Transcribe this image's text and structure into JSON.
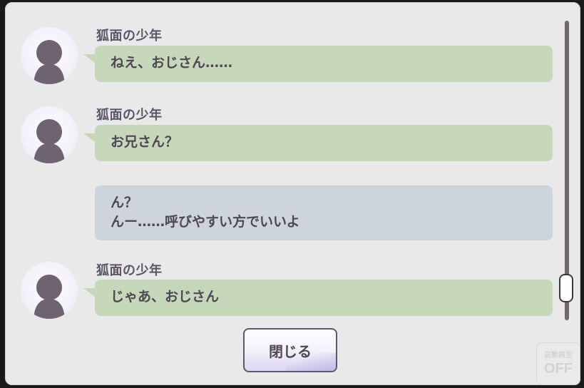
{
  "log": {
    "entries": [
      {
        "speaker": "狐面の少年",
        "text": "ねえ、おじさん……"
      },
      {
        "speaker": "狐面の少年",
        "text": "お兄さん？"
      },
      {
        "speaker": "",
        "lines": [
          "ん？",
          "んー……呼びやすい方でいいよ"
        ]
      },
      {
        "speaker": "狐面の少年",
        "text": "じゃあ、おじさん"
      }
    ]
  },
  "close_button": {
    "label": "閉じる"
  },
  "auto_toggle": {
    "small_label": "自動再生",
    "state": "OFF"
  },
  "colors": {
    "npc_bubble": "#c7d7b9",
    "player_bubble": "#cdd4dc",
    "text": "#4f4656",
    "panel": "#e9e9ea"
  },
  "icons": {
    "avatar": "silhouette-avatar-icon",
    "scroll": "scrollbar-thumb"
  }
}
